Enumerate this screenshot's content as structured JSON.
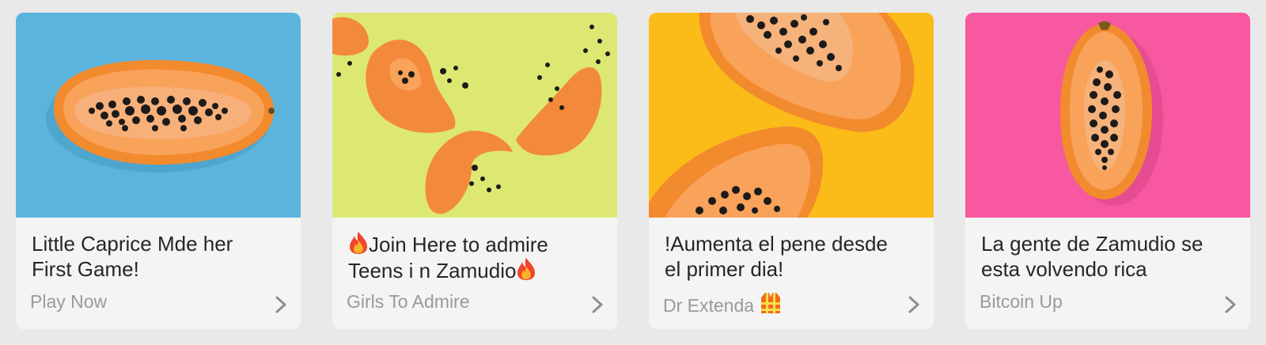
{
  "cards": [
    {
      "title_line1": "Little Caprice Mde her",
      "title_line2": "First Game!",
      "source": "Play Now",
      "image_bg": "#5bb4dc"
    },
    {
      "title_line1": "Join Here to admire",
      "title_line2": "Teens i n Zamudio",
      "source": "Girls To Admire",
      "image_bg": "#dde873"
    },
    {
      "title_line1": "!Aumenta el pene desde",
      "title_line2": "el primer dia!",
      "source": "Dr Extenda",
      "image_bg": "#fbbb18"
    },
    {
      "title_line1": "La gente de Zamudio se",
      "title_line2": "esta volvendo rica",
      "source": "Bitcoin Up",
      "image_bg": "#f7589f"
    }
  ],
  "icons": {
    "chevron": "chevron-right-icon",
    "fire": "fire-emoji-icon",
    "vest": "safety-vest-emoji-icon"
  }
}
